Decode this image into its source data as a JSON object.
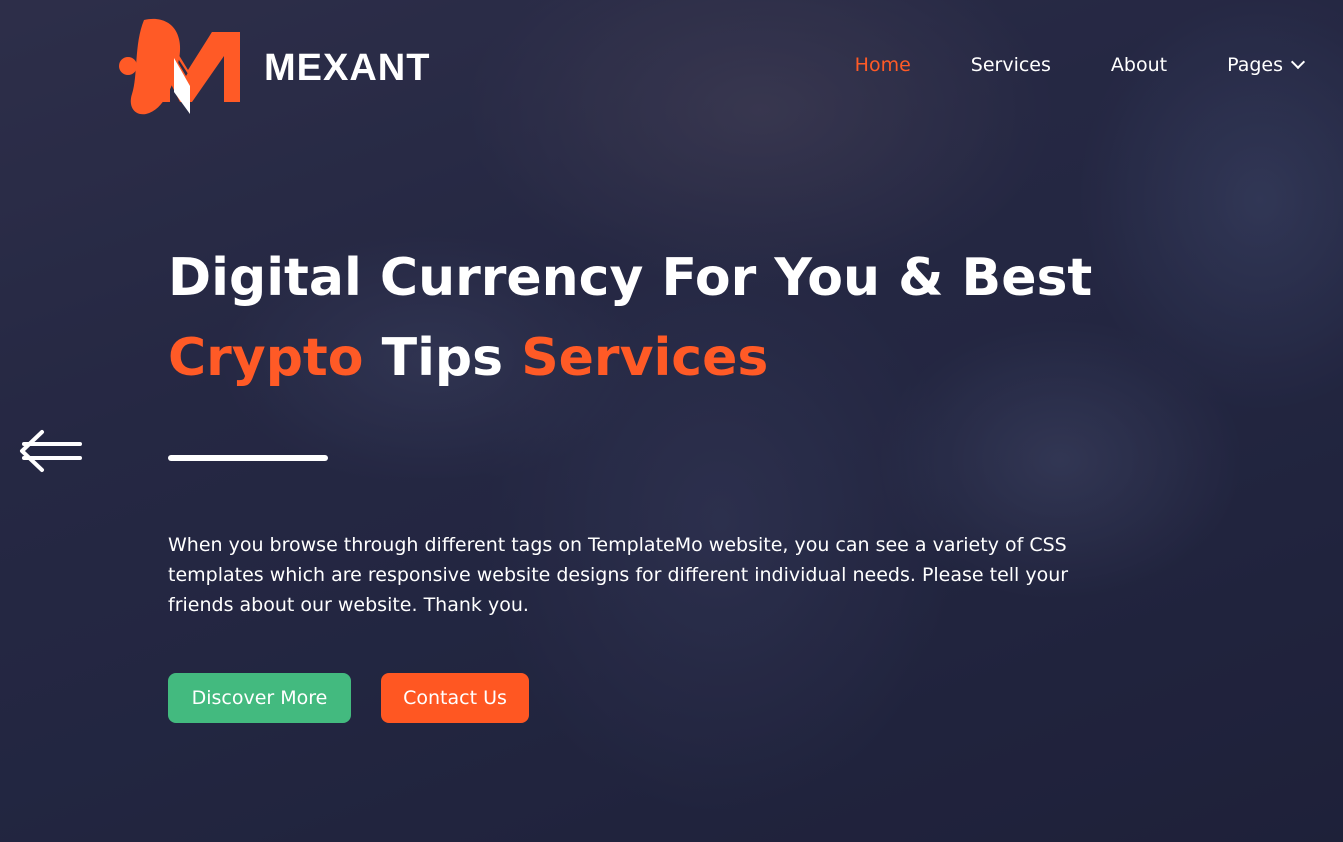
{
  "brand": {
    "name": "MEXANT",
    "logo_icon": "mexant-logo-mark",
    "accent_color": "#ff5a26"
  },
  "nav": {
    "items": [
      {
        "label": "Home",
        "active": true
      },
      {
        "label": "Services",
        "active": false
      },
      {
        "label": "About",
        "active": false
      },
      {
        "label": "Pages",
        "active": false,
        "icon": "chevron-down-icon"
      }
    ]
  },
  "hero": {
    "headline": {
      "line1": "Digital Currency For You & Best",
      "line2_accent1": "Crypto",
      "line2_plain": " Tips ",
      "line2_accent2": "Services"
    },
    "description": "When you browse through different tags on TemplateMo website, you can see a variety of CSS templates which are responsive website designs for different individual needs. Please tell your friends about our website. Thank you.",
    "buttons": {
      "discover_label": "Discover More",
      "discover_color": "#43ba7f",
      "contact_label": "Contact Us",
      "contact_color": "#ff5722"
    },
    "slider_prev_icon": "arrow-left-icon"
  }
}
